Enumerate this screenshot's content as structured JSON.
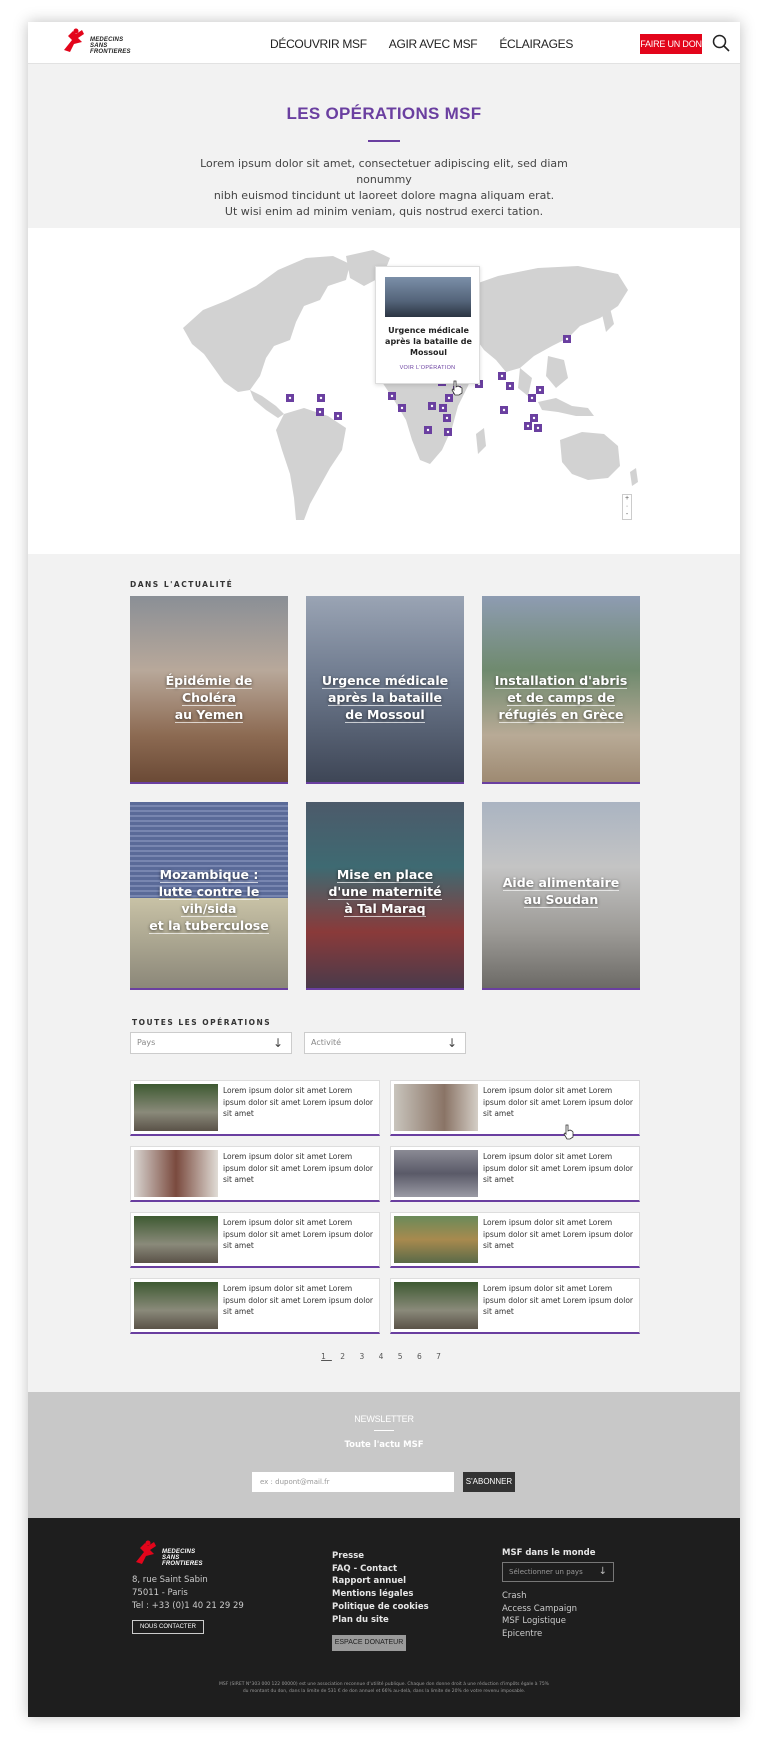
{
  "header": {
    "logo_text_1": "MEDECINS",
    "logo_text_2": "SANS FRONTIERES",
    "nav": [
      "DÉCOUVRIR MSF",
      "AGIR AVEC MSF",
      "ÉCLAIRAGES"
    ],
    "donate_label": "FAIRE UN DON"
  },
  "hero": {
    "title": "LES OPÉRATIONS MSF",
    "text_line1": "Lorem ipsum dolor sit amet, consectetuer adipiscing elit, sed diam nonummy",
    "text_line2": "nibh euismod tincidunt ut laoreet dolore magna aliquam erat.",
    "text_line3": "Ut wisi enim ad minim veniam, quis nostrud exerci tation."
  },
  "map": {
    "popup_title": "Urgence médicale après la bataille de Mossoul",
    "popup_link": "VOIR L'OPÉRATION",
    "zoom_in": "+",
    "zoom_mid": "·",
    "zoom_out": "-"
  },
  "news": {
    "label": "DANS L'ACTUALITÉ",
    "cards": [
      {
        "l1": "Épidémie de",
        "l2": "Choléra",
        "l3": "au Yemen"
      },
      {
        "l1": "Urgence médicale",
        "l2": "après la bataille",
        "l3": "de Mossoul"
      },
      {
        "l1": "Installation d'abris",
        "l2": "et de camps de",
        "l3": "réfugiés en Grèce"
      },
      {
        "l1": "Mozambique :",
        "l2": "lutte contre le vih/sida",
        "l3": "et la tuberculose"
      },
      {
        "l1": "Mise en place",
        "l2": "d'une maternité",
        "l3": "à Tal Maraq"
      },
      {
        "l1": "Aide alimentaire",
        "l2": "au Soudan",
        "l3": ""
      }
    ]
  },
  "operations": {
    "label": "TOUTES LES OPÉRATIONS",
    "filter_country": "Pays",
    "filter_activity": "Activité",
    "item_text": "Lorem ipsum dolor sit amet Lorem ipsum dolor sit amet Lorem ipsum dolor sit amet",
    "pages": [
      "1",
      "2",
      "3",
      "4",
      "5",
      "6",
      "7"
    ]
  },
  "newsletter": {
    "title": "NEWSLETTER",
    "subtitle": "Toute l'actu MSF",
    "placeholder": "ex : dupont@mail.fr",
    "button": "S'ABONNER"
  },
  "footer": {
    "addr1": "8, rue Saint Sabin",
    "addr2": "75011 - Paris",
    "addr3": "Tel : +33 (0)1 40 21 29 29",
    "contact": "NOUS CONTACTER",
    "links": [
      "Presse",
      "FAQ - Contact",
      "Rapport annuel",
      "Mentions légales",
      "Politique de cookies",
      "Plan du site"
    ],
    "espace": "ESPACE DONATEUR",
    "world_title": "MSF dans le monde",
    "country_select": "Sélectionner un pays",
    "world_links": [
      "Crash",
      "Access Campaign",
      "MSF Logistique",
      "Epicentre"
    ],
    "legal1": "MSF (SIRET N°303 000 122 00000) est une association reconnue d'utilité publique. Chaque don donne droit à une réduction d'impôts égale à 75%",
    "legal2": "du montant du don, dans la limite de 531 € de don annuel et 66% au-delà, dans la limite de 20% de votre revenu imposable."
  },
  "colors": {
    "accent": "#6a3fa0",
    "brand_red": "#e3051b",
    "footer_bg": "#1e1e1e"
  }
}
